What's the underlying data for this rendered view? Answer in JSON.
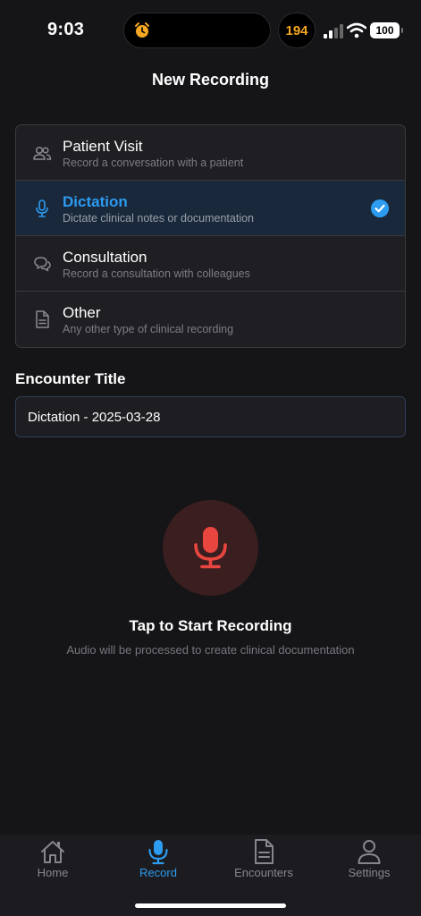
{
  "status_bar": {
    "time": "9:03",
    "activity_count": "194",
    "battery": "100"
  },
  "header": {
    "title": "New Recording"
  },
  "recording_types": [
    {
      "label": "Patient Visit",
      "description": "Record a conversation with a patient",
      "icon": "users-icon",
      "selected": false
    },
    {
      "label": "Dictation",
      "description": "Dictate clinical notes or documentation",
      "icon": "microphone-icon",
      "selected": true
    },
    {
      "label": "Consultation",
      "description": "Record a consultation with colleagues",
      "icon": "chat-bubbles-icon",
      "selected": false
    },
    {
      "label": "Other",
      "description": "Any other type of clinical recording",
      "icon": "document-icon",
      "selected": false
    }
  ],
  "encounter": {
    "label": "Encounter Title",
    "value": "Dictation - 2025-03-28"
  },
  "record": {
    "title": "Tap to Start Recording",
    "subtitle": "Audio will be processed to create clinical documentation"
  },
  "tabs": [
    {
      "label": "Home",
      "icon": "home-icon",
      "active": false
    },
    {
      "label": "Record",
      "icon": "microphone-icon",
      "active": true
    },
    {
      "label": "Encounters",
      "icon": "document-icon",
      "active": false
    },
    {
      "label": "Settings",
      "icon": "person-icon",
      "active": false
    }
  ],
  "colors": {
    "accent": "#2d9bf0",
    "record": "#e8463f",
    "background": "#151417",
    "alarm": "#f5a623"
  }
}
